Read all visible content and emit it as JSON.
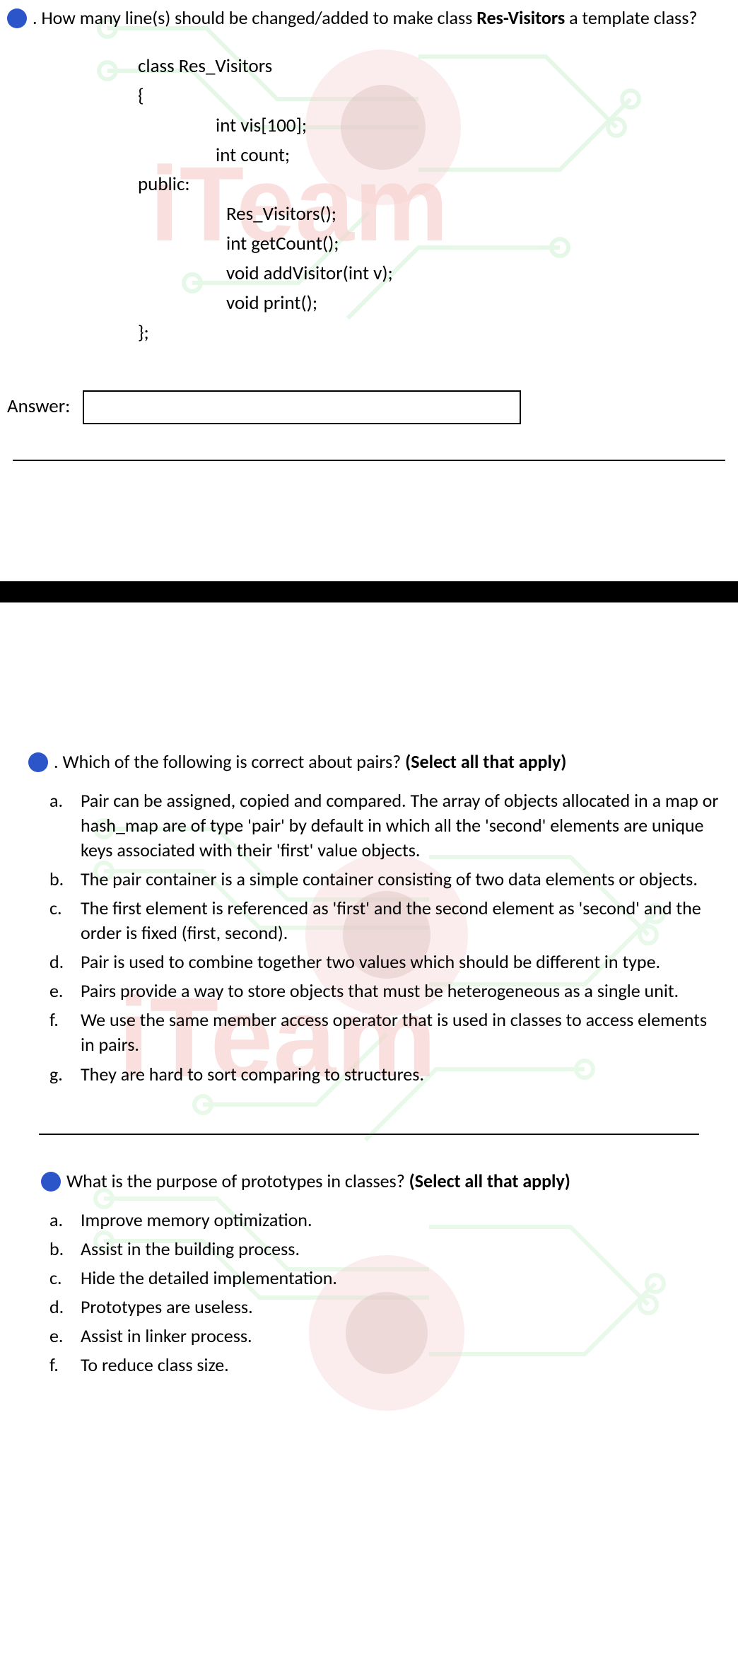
{
  "q1": {
    "prompt_prefix": ". How many line(s) should be changed/added to make class ",
    "prompt_bold": "Res-Visitors",
    "prompt_suffix": " a template class?",
    "code": {
      "l1": "class Res_Visitors",
      "l2": "{",
      "l3": "int vis[100];",
      "l4": "int count;",
      "l5": "public:",
      "l6": "Res_Visitors();",
      "l7": "int getCount();",
      "l8": "void addVisitor(int v);",
      "l9": "void print();",
      "l10": "};"
    },
    "answer_label": "Answer:",
    "answer_value": ""
  },
  "q2": {
    "prompt_prefix": ". Which of the following is correct about pairs? ",
    "prompt_bold": "(Select all that apply)",
    "options": [
      {
        "letter": "a.",
        "text": "Pair can be assigned, copied and compared. The array of objects allocated in a map or hash_map are of type 'pair' by default in which all the 'second' elements are unique keys associated with their 'first' value objects."
      },
      {
        "letter": "b.",
        "text": "The pair container is a simple container consisting of two data elements or objects."
      },
      {
        "letter": "c.",
        "text": "The first element is referenced as 'first' and the second element as 'second' and the order is fixed (first, second)."
      },
      {
        "letter": "d.",
        "text": "Pair is used to combine together two values which should be different in type."
      },
      {
        "letter": "e.",
        "text": "Pairs provide a way to store objects that must be heterogeneous as a single unit."
      },
      {
        "letter": "f.",
        "text": "We use the same member access operator that is used in classes to access elements in pairs."
      },
      {
        "letter": "g.",
        "text": "They are hard to sort comparing to structures."
      }
    ]
  },
  "q3": {
    "prompt_prefix": "What is the purpose of prototypes in classes? ",
    "prompt_bold": "(Select all that apply)",
    "options": [
      {
        "letter": "a.",
        "text": "Improve memory optimization."
      },
      {
        "letter": "b.",
        "text": "Assist in the building process."
      },
      {
        "letter": "c.",
        "text": "Hide the detailed implementation."
      },
      {
        "letter": "d.",
        "text": "Prototypes are useless."
      },
      {
        "letter": "e.",
        "text": "Assist in linker process."
      },
      {
        "letter": "f.",
        "text": "To reduce class size."
      }
    ]
  },
  "watermark": {
    "brand": "iTeam"
  }
}
